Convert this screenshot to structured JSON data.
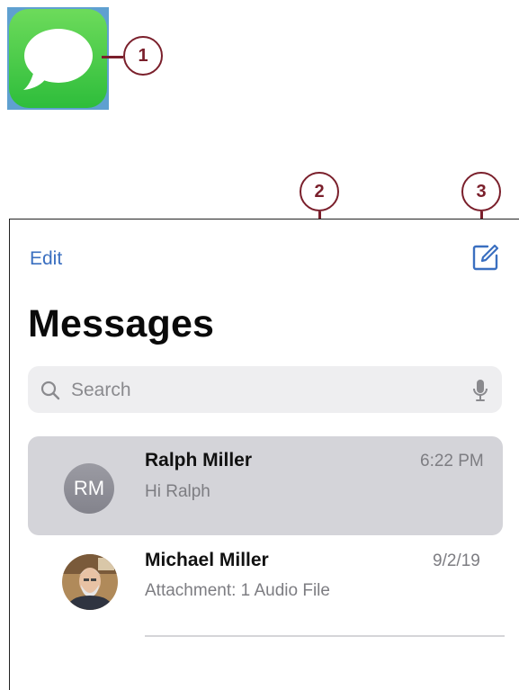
{
  "callouts": {
    "one": "1",
    "two": "2",
    "three": "3"
  },
  "colors": {
    "callout": "#7a1f2b",
    "link": "#3a6fc0",
    "selected_row": "#d4d4d9",
    "app_green": "#2ebd3b"
  },
  "icons": {
    "app": "messages-app-icon",
    "compose": "compose-icon",
    "search": "search-icon",
    "mic": "microphone-icon"
  },
  "nav": {
    "edit_label": "Edit",
    "title": "Messages"
  },
  "search": {
    "placeholder": "Search"
  },
  "conversations": [
    {
      "initials": "RM",
      "name": "Ralph Miller",
      "preview": "Hi Ralph",
      "time": "6:22 PM",
      "selected": true
    },
    {
      "initials": "",
      "name": "Michael Miller",
      "preview": "Attachment: 1 Audio File",
      "time": "9/2/19",
      "selected": false
    }
  ]
}
